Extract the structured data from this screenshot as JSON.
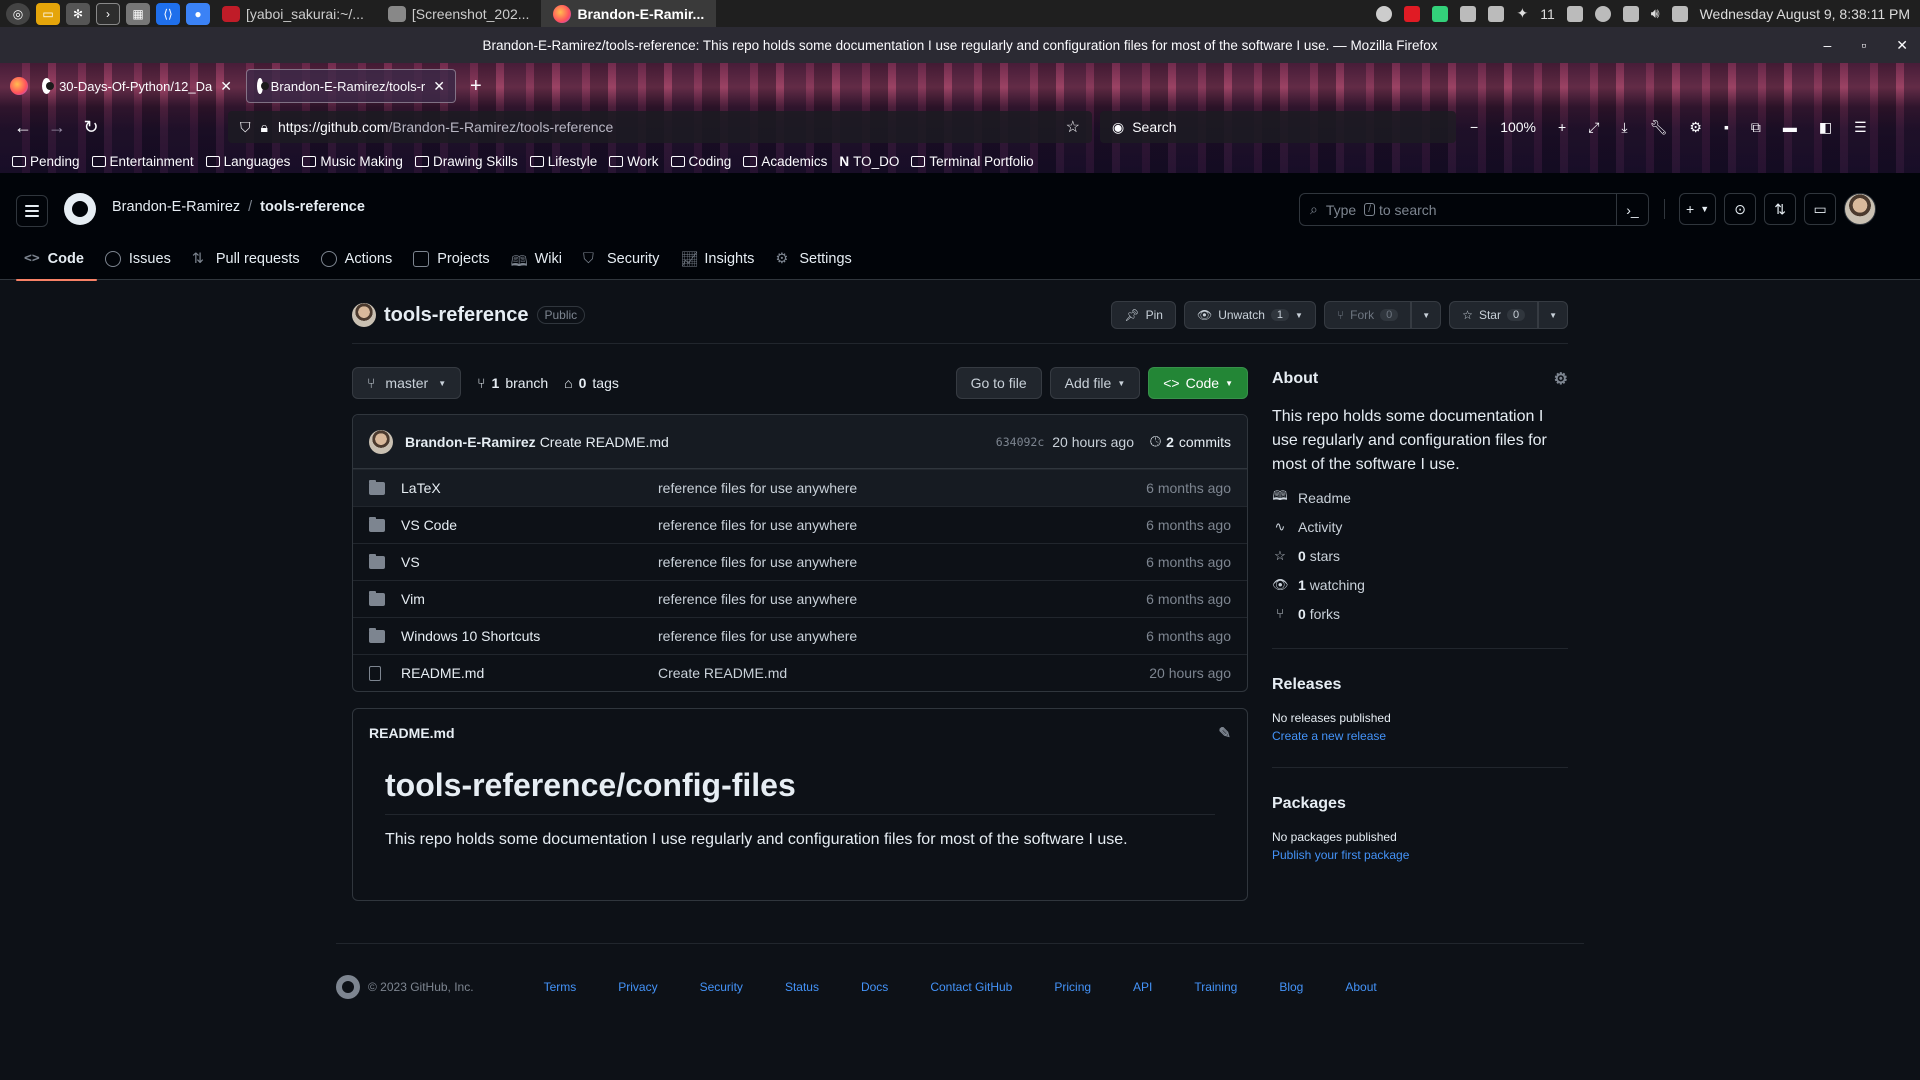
{
  "system_bar": {
    "tasks": [
      {
        "label": "[yaboi_sakurai:~/...",
        "active": false
      },
      {
        "label": "[Screenshot_202...",
        "active": false
      },
      {
        "label": "Brandon-E-Ramir...",
        "active": true
      }
    ],
    "battery_count": "11",
    "clock": "Wednesday August  9, 8:38:11 PM"
  },
  "window": {
    "title": "Brandon-E-Ramirez/tools-reference: This repo holds some documentation I use regularly and configuration files for most of the software I use. — Mozilla Firefox"
  },
  "browser": {
    "tabs": [
      {
        "label": "30-Days-Of-Python/12_Da",
        "active": false
      },
      {
        "label": "Brandon-E-Ramirez/tools-r",
        "active": true
      }
    ],
    "url_host": "https://github.com",
    "url_path": "/Brandon-E-Ramirez/tools-reference",
    "search_placeholder": "Search",
    "zoom": "100%",
    "bookmarks": [
      "Pending",
      "Entertainment",
      "Languages",
      "Music Making",
      "Drawing Skills",
      "Lifestyle",
      "Work",
      "Coding",
      "Academics",
      "TO_DO",
      "Terminal Portfolio"
    ]
  },
  "gh_header": {
    "owner": "Brandon-E-Ramirez",
    "separator": "/",
    "repo": "tools-reference",
    "search_pre": "Type",
    "search_key": "/",
    "search_post": "to search"
  },
  "repo_nav": [
    {
      "label": "Code",
      "icon": "code-icon",
      "active": true
    },
    {
      "label": "Issues",
      "icon": "issue-icon",
      "active": false
    },
    {
      "label": "Pull requests",
      "icon": "pull-request-icon",
      "active": false
    },
    {
      "label": "Actions",
      "icon": "play-icon",
      "active": false
    },
    {
      "label": "Projects",
      "icon": "table-icon",
      "active": false
    },
    {
      "label": "Wiki",
      "icon": "book-icon",
      "active": false
    },
    {
      "label": "Security",
      "icon": "shield-icon",
      "active": false
    },
    {
      "label": "Insights",
      "icon": "graph-icon",
      "active": false
    },
    {
      "label": "Settings",
      "icon": "gear-icon",
      "active": false
    }
  ],
  "repo": {
    "name": "tools-reference",
    "visibility": "Public",
    "pin_label": "Pin",
    "unwatch_label": "Unwatch",
    "watch_count": "1",
    "fork_label": "Fork",
    "fork_count": "0",
    "star_label": "Star",
    "star_count": "0"
  },
  "controls": {
    "branch": "master",
    "branch_count": "1",
    "branch_label": "branch",
    "tag_count": "0",
    "tag_label": "tags",
    "go_to_file": "Go to file",
    "add_file": "Add file",
    "code": "Code"
  },
  "latest_commit": {
    "author": "Brandon-E-Ramirez",
    "message": "Create README.md",
    "sha": "634092c",
    "age": "20 hours ago",
    "commit_count": "2",
    "commit_label": "commits"
  },
  "files": [
    {
      "name": "LaTeX",
      "type": "dir",
      "message": "reference files for use anywhere",
      "age": "6 months ago"
    },
    {
      "name": "VS Code",
      "type": "dir",
      "message": "reference files for use anywhere",
      "age": "6 months ago"
    },
    {
      "name": "VS",
      "type": "dir",
      "message": "reference files for use anywhere",
      "age": "6 months ago"
    },
    {
      "name": "Vim",
      "type": "dir",
      "message": "reference files for use anywhere",
      "age": "6 months ago"
    },
    {
      "name": "Windows 10 Shortcuts",
      "type": "dir",
      "message": "reference files for use anywhere",
      "age": "6 months ago"
    },
    {
      "name": "README.md",
      "type": "file",
      "message": "Create README.md",
      "age": "20 hours ago"
    }
  ],
  "readme": {
    "filename": "README.md",
    "heading": "tools-reference/config-files",
    "paragraph": "This repo holds some documentation I use regularly and configuration files for most of the software I use."
  },
  "about": {
    "title": "About",
    "description": "This repo holds some documentation I use regularly and configuration files for most of the software I use.",
    "readme": "Readme",
    "activity": "Activity",
    "stars_count": "0",
    "stars_label": "stars",
    "watching_count": "1",
    "watching_label": "watching",
    "forks_count": "0",
    "forks_label": "forks"
  },
  "releases": {
    "title": "Releases",
    "empty": "No releases published",
    "link": "Create a new release"
  },
  "packages": {
    "title": "Packages",
    "empty": "No packages published",
    "link": "Publish your first package"
  },
  "footer": {
    "copyright": "© 2023 GitHub, Inc.",
    "links": [
      "Terms",
      "Privacy",
      "Security",
      "Status",
      "Docs",
      "Contact GitHub",
      "Pricing",
      "API",
      "Training",
      "Blog",
      "About"
    ]
  },
  "colors": {
    "accent_green": "#238636",
    "tab_underline": "#f78166",
    "link_blue": "#4493f8",
    "bg": "#0d1117"
  }
}
